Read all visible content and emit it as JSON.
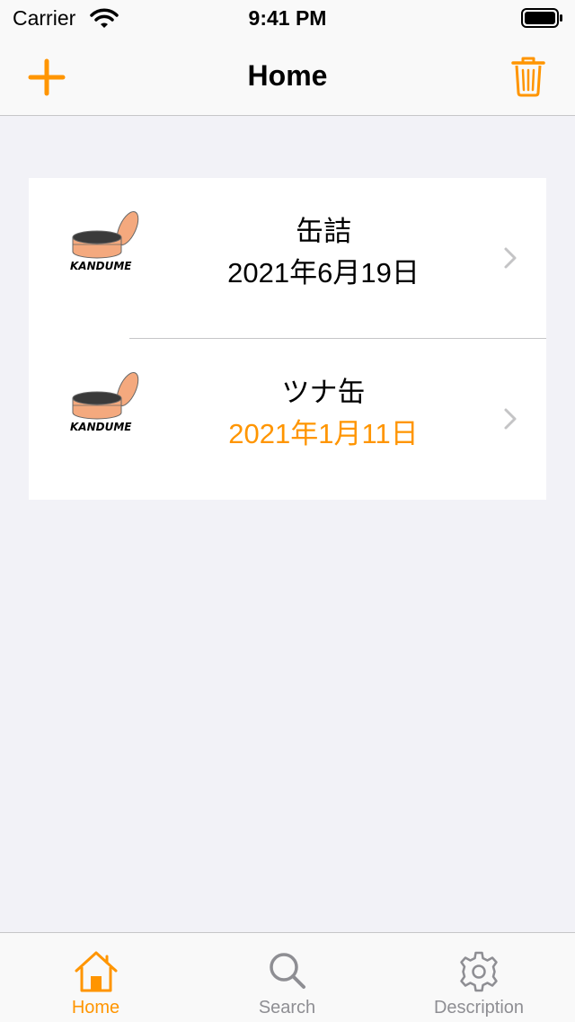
{
  "status_bar": {
    "carrier": "Carrier",
    "time": "9:41 PM"
  },
  "nav": {
    "title": "Home",
    "add_icon": "plus-icon",
    "trash_icon": "trash-icon"
  },
  "colors": {
    "accent": "#ff9500",
    "gray": "#8e8e93",
    "background": "#f2f2f7"
  },
  "items": [
    {
      "title": "缶詰",
      "date": "2021年6月19日",
      "logo_text": "KANDUME",
      "date_color": "#000000"
    },
    {
      "title": "ツナ缶",
      "date": "2021年1月11日",
      "logo_text": "KANDUME",
      "date_color": "#ff9500"
    }
  ],
  "tabs": [
    {
      "label": "Home",
      "icon": "home-icon",
      "selected": true
    },
    {
      "label": "Search",
      "icon": "search-icon",
      "selected": false
    },
    {
      "label": "Description",
      "icon": "gear-icon",
      "selected": false
    }
  ]
}
